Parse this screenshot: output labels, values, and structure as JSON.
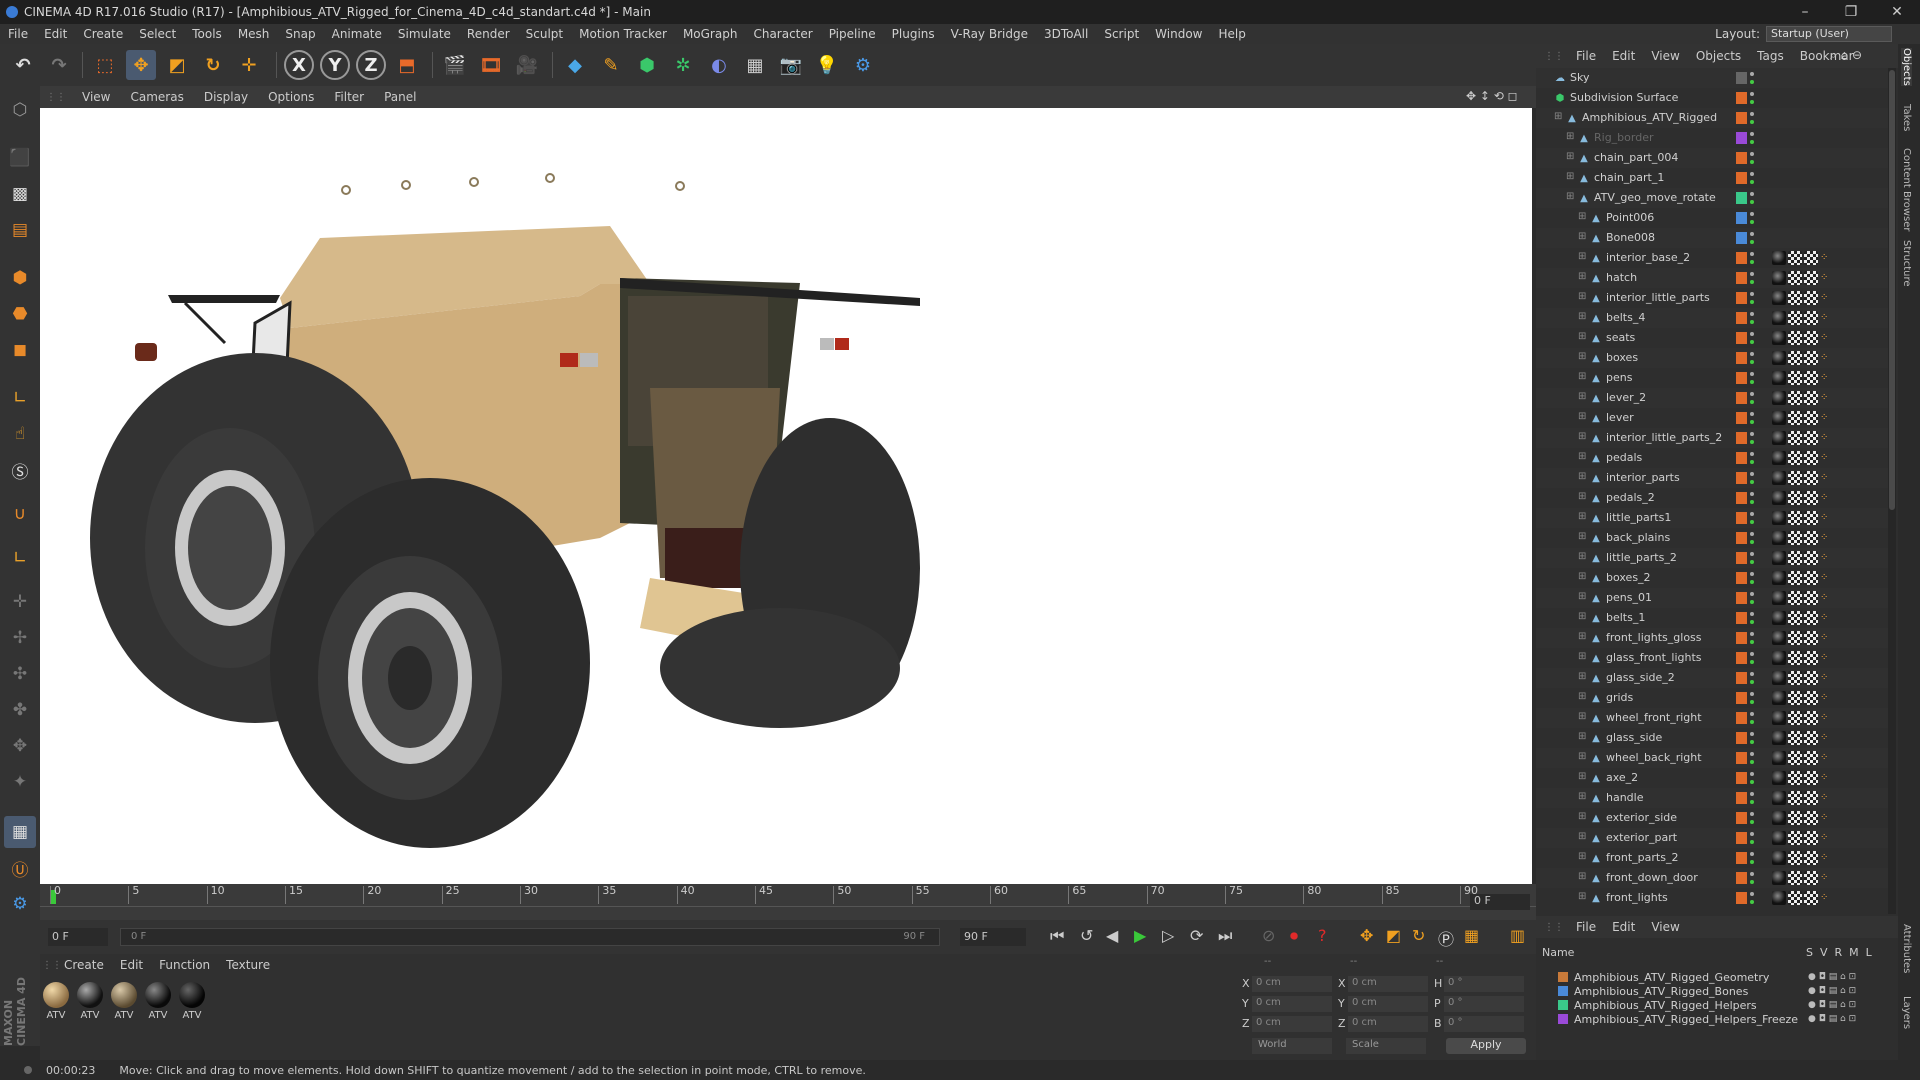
{
  "window": {
    "title": "CINEMA 4D R17.016 Studio (R17) - [Amphibious_ATV_Rigged_for_Cinema_4D_c4d_standart.c4d *] - Main"
  },
  "menu": [
    "File",
    "Edit",
    "Create",
    "Select",
    "Tools",
    "Mesh",
    "Snap",
    "Animate",
    "Simulate",
    "Render",
    "Sculpt",
    "Motion Tracker",
    "MoGraph",
    "Character",
    "Pipeline",
    "Plugins",
    "V-Ray Bridge",
    "3DToAll",
    "Script",
    "Window",
    "Help"
  ],
  "layout": {
    "label": "Layout:",
    "value": "Startup (User)"
  },
  "viewport_menu": [
    "View",
    "Cameras",
    "Display",
    "Options",
    "Filter",
    "Panel"
  ],
  "timeline": {
    "ticks": [
      "0",
      "5",
      "10",
      "15",
      "20",
      "25",
      "30",
      "35",
      "40",
      "45",
      "50",
      "55",
      "60",
      "65",
      "70",
      "75",
      "80",
      "85",
      "90"
    ],
    "end_field": "0 F"
  },
  "playbar": {
    "start": "0 F",
    "range_start": "0 F",
    "range_end": "90 F",
    "end": "90 F"
  },
  "material_menu": [
    "Create",
    "Edit",
    "Function",
    "Texture"
  ],
  "materials": [
    "ATV",
    "ATV",
    "ATV",
    "ATV",
    "ATV"
  ],
  "coords": {
    "rows": [
      {
        "a": "X",
        "av": "0 cm",
        "b": "X",
        "bv": "0 cm",
        "c": "H",
        "cv": "0 °"
      },
      {
        "a": "Y",
        "av": "0 cm",
        "b": "Y",
        "bv": "0 cm",
        "c": "P",
        "cv": "0 °"
      },
      {
        "a": "Z",
        "av": "0 cm",
        "b": "Z",
        "bv": "0 cm",
        "c": "B",
        "cv": "0 °"
      }
    ],
    "mode": "World",
    "scale": "Scale",
    "apply": "Apply",
    "header_a": "--",
    "header_b": "--",
    "header_c": "--"
  },
  "object_menu": [
    "File",
    "Edit",
    "View",
    "Objects",
    "Tags",
    "Bookmar"
  ],
  "objects": [
    {
      "name": "Sky",
      "indent": 0
    },
    {
      "name": "Subdivision Surface",
      "indent": 0
    },
    {
      "name": "Amphibious_ATV_Rigged",
      "indent": 1
    },
    {
      "name": "Rig_border",
      "indent": 2
    },
    {
      "name": "chain_part_004",
      "indent": 2
    },
    {
      "name": "chain_part_1",
      "indent": 2
    },
    {
      "name": "ATV_geo_move_rotate",
      "indent": 2
    },
    {
      "name": "Point006",
      "indent": 3
    },
    {
      "name": "Bone008",
      "indent": 3
    },
    {
      "name": "interior_base_2",
      "indent": 3
    },
    {
      "name": "hatch",
      "indent": 3
    },
    {
      "name": "interior_little_parts",
      "indent": 3
    },
    {
      "name": "belts_4",
      "indent": 3
    },
    {
      "name": "seats",
      "indent": 3
    },
    {
      "name": "boxes",
      "indent": 3
    },
    {
      "name": "pens",
      "indent": 3
    },
    {
      "name": "lever_2",
      "indent": 3
    },
    {
      "name": "lever",
      "indent": 3
    },
    {
      "name": "interior_little_parts_2",
      "indent": 3
    },
    {
      "name": "pedals",
      "indent": 3
    },
    {
      "name": "interior_parts",
      "indent": 3
    },
    {
      "name": "pedals_2",
      "indent": 3
    },
    {
      "name": "little_parts1",
      "indent": 3
    },
    {
      "name": "back_plains",
      "indent": 3
    },
    {
      "name": "little_parts_2",
      "indent": 3
    },
    {
      "name": "boxes_2",
      "indent": 3
    },
    {
      "name": "pens_01",
      "indent": 3
    },
    {
      "name": "belts_1",
      "indent": 3
    },
    {
      "name": "front_lights_gloss",
      "indent": 3
    },
    {
      "name": "glass_front_lights",
      "indent": 3
    },
    {
      "name": "glass_side_2",
      "indent": 3
    },
    {
      "name": "grids",
      "indent": 3
    },
    {
      "name": "wheel_front_right",
      "indent": 3
    },
    {
      "name": "glass_side",
      "indent": 3
    },
    {
      "name": "wheel_back_right",
      "indent": 3
    },
    {
      "name": "axe_2",
      "indent": 3
    },
    {
      "name": "handle",
      "indent": 3
    },
    {
      "name": "exterior_side",
      "indent": 3
    },
    {
      "name": "exterior_part",
      "indent": 3
    },
    {
      "name": "front_parts_2",
      "indent": 3
    },
    {
      "name": "front_down_door",
      "indent": 3
    },
    {
      "name": "front_lights",
      "indent": 3
    }
  ],
  "layer_menu": [
    "File",
    "Edit",
    "View"
  ],
  "layer_header": {
    "name": "Name",
    "cols": [
      "S",
      "V",
      "R",
      "M",
      "L"
    ]
  },
  "layers": [
    {
      "name": "Amphibious_ATV_Rigged_Geometry",
      "color": "#c87a3a"
    },
    {
      "name": "Amphibious_ATV_Rigged_Bones",
      "color": "#4a8ad8"
    },
    {
      "name": "Amphibious_ATV_Rigged_Helpers",
      "color": "#3ac88a"
    },
    {
      "name": "Amphibious_ATV_Rigged_Helpers_Freeze",
      "color": "#9a4ad8"
    }
  ],
  "side_tabs": [
    "Objects",
    "Takes",
    "Content Browser",
    "Structure"
  ],
  "side_tabs_bottom": [
    "Attributes",
    "Layers"
  ],
  "status": {
    "time": "00:00:23",
    "message": "Move: Click and drag to move elements. Hold down SHIFT to quantize movement / add to the selection in point mode, CTRL to remove."
  },
  "brand": "MAXON CINEMA 4D"
}
